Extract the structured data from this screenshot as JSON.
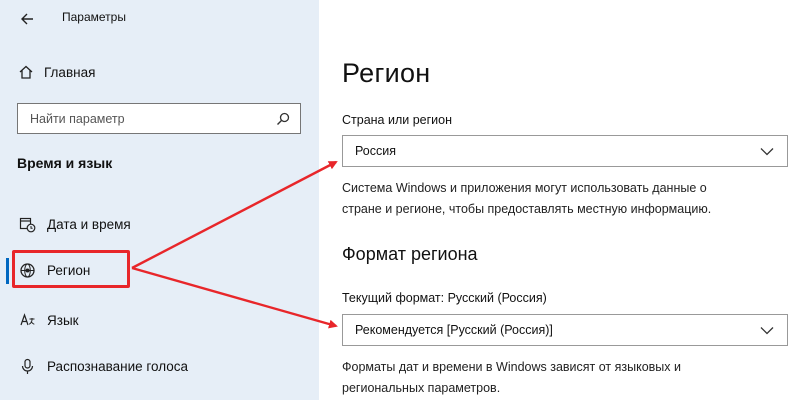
{
  "window": {
    "title": "Параметры"
  },
  "sidebar": {
    "home_label": "Главная",
    "search_placeholder": "Найти параметр",
    "section_title": "Время и язык",
    "items": [
      {
        "label": "Дата и время",
        "icon": "calendar-clock-icon"
      },
      {
        "label": "Регион",
        "icon": "globe-icon",
        "selected": true
      },
      {
        "label": "Язык",
        "icon": "language-icon"
      },
      {
        "label": "Распознавание голоса",
        "icon": "microphone-icon"
      }
    ]
  },
  "main": {
    "title": "Регион",
    "country_label": "Страна или регион",
    "country_value": "Россия",
    "country_desc_line1": "Система Windows и приложения могут использовать данные о",
    "country_desc_line2": "стране и регионе, чтобы предоставлять местную информацию.",
    "format_title": "Формат региона",
    "format_label": "Текущий формат: Русский (Россия)",
    "format_value": "Рекомендуется [Русский (Россия)]",
    "format_desc_line1": "Форматы дат и времени в Windows зависят от языковых и",
    "format_desc_line2": "региональных параметров."
  },
  "colors": {
    "sidebar_bg": "#e6eef7",
    "accent": "#0067c0",
    "annotation_red": "#e8262a"
  }
}
